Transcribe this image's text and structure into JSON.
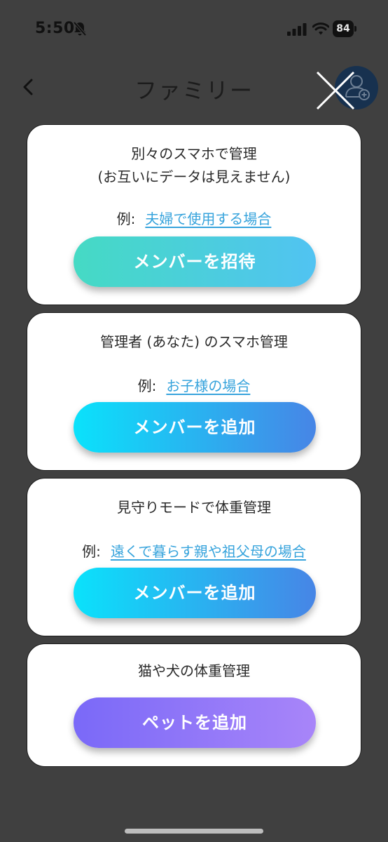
{
  "status_bar": {
    "time": "5:50",
    "battery": "84"
  },
  "header": {
    "title": "ファミリー"
  },
  "cards": [
    {
      "title_line1": "別々のスマホで管理",
      "title_line2": "(お互いにデータは見えません)",
      "example_label": "例:",
      "example_link": "夫婦で使用する場合",
      "button_label": "メンバーを招待"
    },
    {
      "title_line1": "管理者 (あなた) のスマホ管理",
      "example_label": "例:",
      "example_link": "お子様の場合",
      "button_label": "メンバーを追加"
    },
    {
      "title_line1": "見守りモードで体重管理",
      "example_label": "例:",
      "example_link": "遠くで暮らす親や祖父母の場合",
      "button_label": "メンバーを追加"
    },
    {
      "title_line1": "猫や犬の体重管理",
      "button_label": "ペットを追加"
    }
  ],
  "colors": {
    "overlay": "#404040",
    "link": "#36a3dc",
    "invite_gradient": [
      "#45dac4",
      "#51c3f2"
    ],
    "add_gradient": [
      "#0ae2fb",
      "#4785e6"
    ],
    "pet_gradient": [
      "#7a69f8",
      "#a885f9"
    ]
  },
  "icons": {
    "silent": "bell-slash-icon",
    "signal": "cellular-signal-icon",
    "wifi": "wifi-icon",
    "back": "chevron-left-icon",
    "add_member": "user-plus-icon",
    "close": "close-icon"
  }
}
